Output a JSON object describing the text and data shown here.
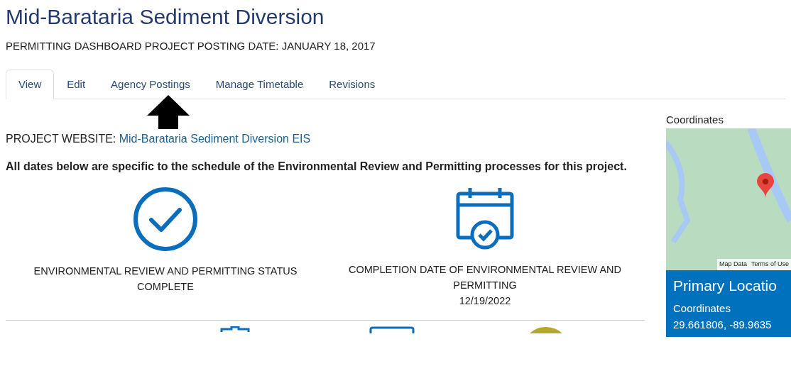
{
  "title": "Mid-Barataria Sediment Diversion",
  "subtitle": "PERMITTING DASHBOARD PROJECT POSTING DATE: JANUARY 18, 2017",
  "tabs": [
    {
      "label": "View",
      "selected": true
    },
    {
      "label": "Edit",
      "selected": false
    },
    {
      "label": "Agency Postings",
      "selected": false
    },
    {
      "label": "Manage Timetable",
      "selected": false
    },
    {
      "label": "Revisions",
      "selected": false
    }
  ],
  "website": {
    "label": "PROJECT WEBSITE:",
    "link": "Mid-Barataria Sediment Diversion EIS"
  },
  "notice": "All dates below are specific to the schedule of the Environmental Review and Permitting processes for this project.",
  "status_items": [
    {
      "kind": "check",
      "lines": [
        "ENVIRONMENTAL REVIEW AND PERMITTING STATUS",
        "COMPLETE"
      ]
    },
    {
      "kind": "calendar",
      "lines": [
        "COMPLETION DATE OF ENVIRONMENTAL REVIEW AND PERMITTING",
        "12/19/2022"
      ]
    }
  ],
  "map": {
    "heading": "Coordinates",
    "map_data": "Map Data",
    "terms": "Terms of Use"
  },
  "location": {
    "title": "Primary Locatio",
    "label": "Coordinates",
    "value": "29.661806, -89.9635"
  }
}
